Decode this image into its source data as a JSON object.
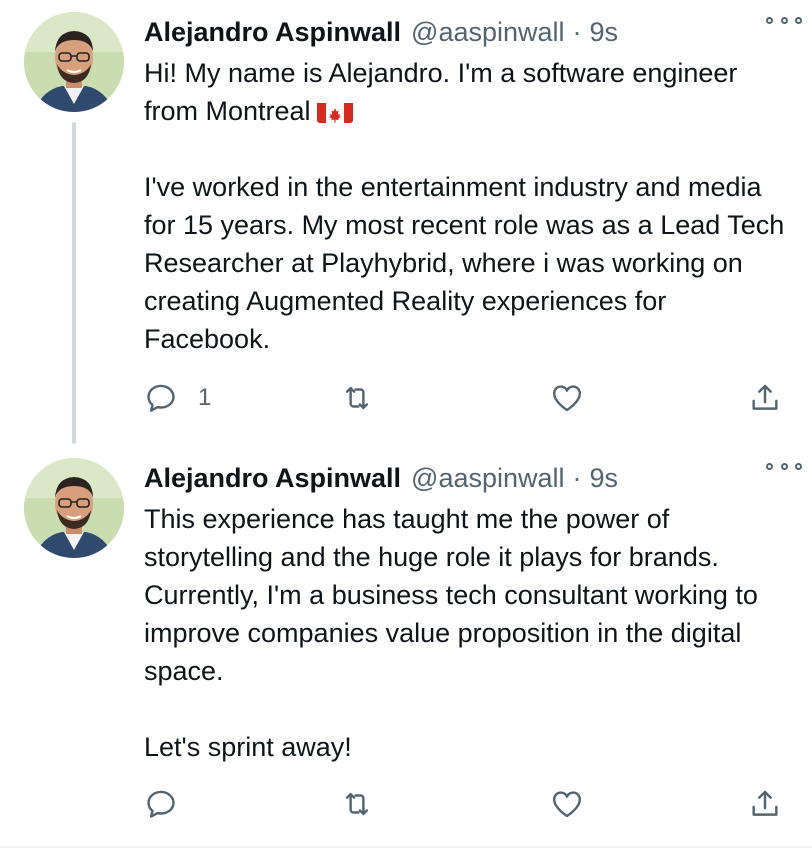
{
  "tweets": [
    {
      "author_name": "Alejandro Aspinwall",
      "handle": "@aaspinwall",
      "separator": "·",
      "time": "9s",
      "paragraphs": [
        "Hi! My name is Alejandro. I'm a software engineer from Montreal",
        "I've worked in the entertainment industry and media for 15 years. My most recent role was as a Lead Tech Researcher at Playhybrid, where i was working on creating Augmented Reality experiences for Facebook."
      ],
      "flag_icon": "canada-flag-icon",
      "reply_count": "1",
      "icons": {
        "more": "more-icon",
        "reply": "reply-icon",
        "retweet": "retweet-icon",
        "like": "heart-icon",
        "share": "share-icon"
      }
    },
    {
      "author_name": "Alejandro Aspinwall",
      "handle": "@aaspinwall",
      "separator": "·",
      "time": "9s",
      "paragraphs": [
        "This experience has taught me the power of storytelling and the huge role it plays for brands. Currently, I'm a business tech consultant working to improve companies value proposition in the digital space.",
        "Let's sprint away!"
      ],
      "reply_count": "",
      "icons": {
        "more": "more-icon",
        "reply": "reply-icon",
        "retweet": "retweet-icon",
        "like": "heart-icon",
        "share": "share-icon"
      }
    }
  ],
  "colors": {
    "text_primary": "#0f1419",
    "text_secondary": "#536471",
    "thread_line": "#cfd9de",
    "flag_red": "#d52b1e"
  }
}
